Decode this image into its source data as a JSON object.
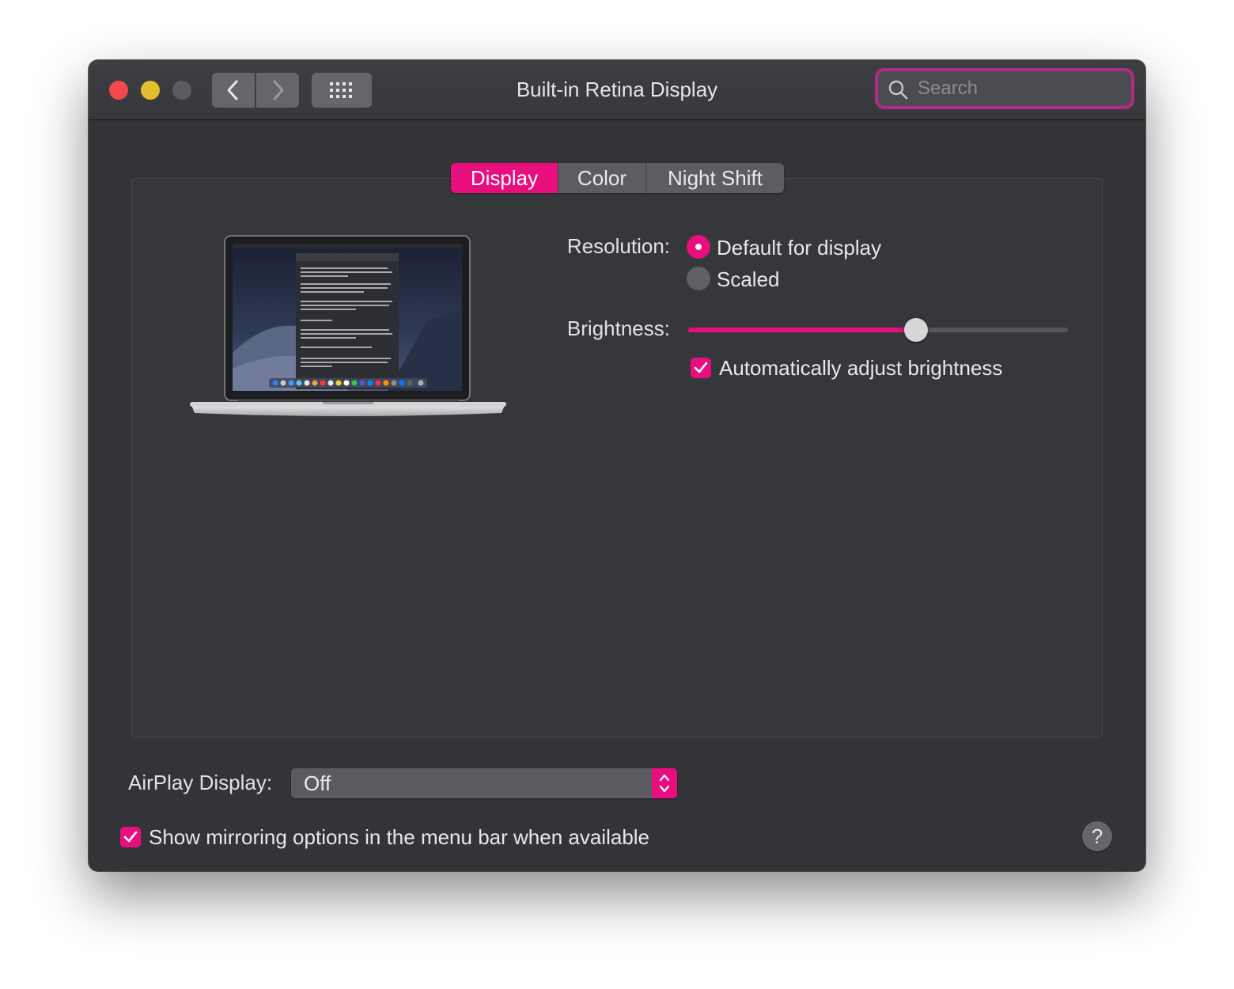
{
  "window": {
    "title": "Built-in Retina Display",
    "search_placeholder": "Search"
  },
  "tabs": [
    {
      "label": "Display",
      "active": true
    },
    {
      "label": "Color",
      "active": false
    },
    {
      "label": "Night Shift",
      "active": false
    }
  ],
  "display": {
    "resolution_label": "Resolution:",
    "resolution_options": [
      {
        "label": "Default for display",
        "selected": true
      },
      {
        "label": "Scaled",
        "selected": false
      }
    ],
    "brightness_label": "Brightness:",
    "brightness_value": 0.6,
    "auto_brightness_label": "Automatically adjust brightness",
    "auto_brightness_checked": true
  },
  "airplay": {
    "label": "AirPlay Display:",
    "value": "Off"
  },
  "mirroring": {
    "label": "Show mirroring options in the menu bar when available",
    "checked": true
  },
  "help_label": "?",
  "colors": {
    "accent": "#e80e7e",
    "window_bg": "#333438",
    "control_bg": "#5c5d61"
  },
  "icons": [
    "close-dot",
    "minimize-dot",
    "zoom-dot",
    "chevron-left-icon",
    "chevron-right-icon",
    "grid-icon",
    "search-icon",
    "checkmark-icon",
    "stepper-arrows-icon",
    "help-icon"
  ]
}
